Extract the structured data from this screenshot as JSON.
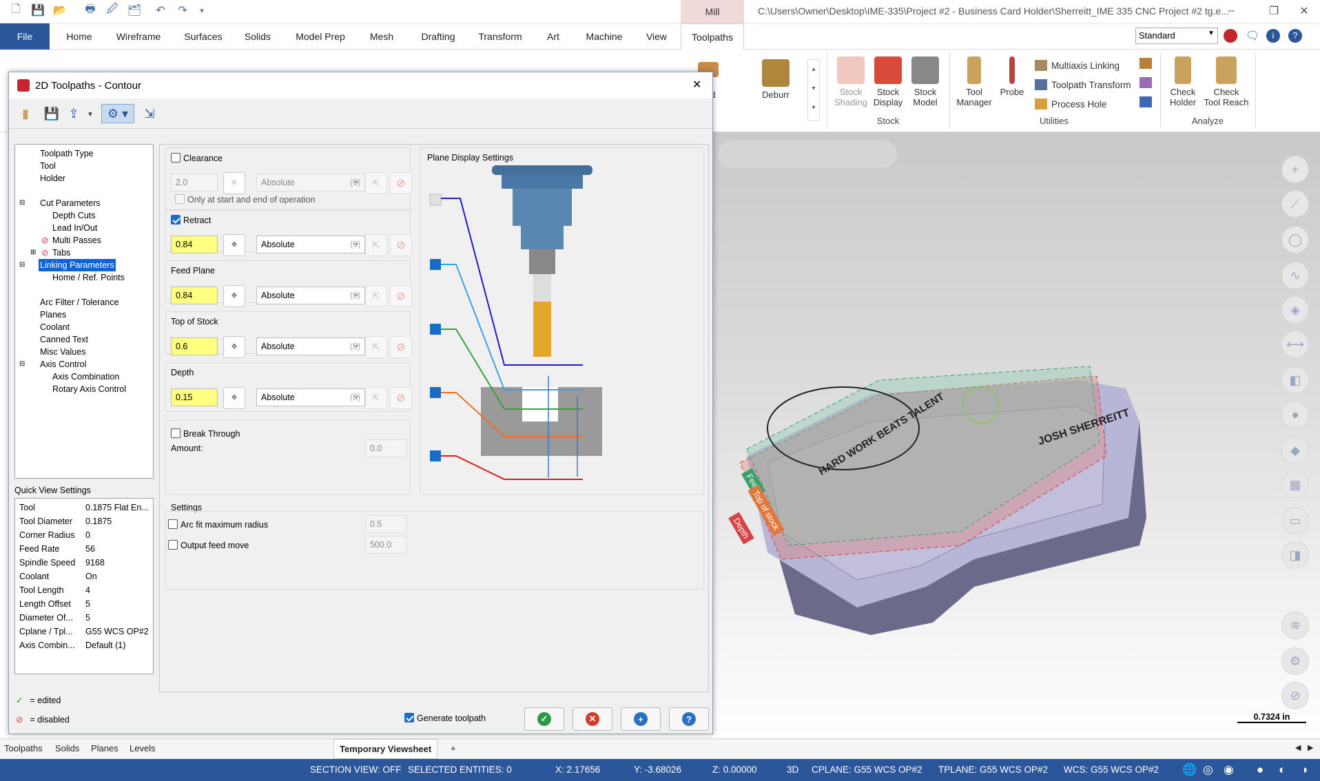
{
  "window": {
    "title": "C:\\Users\\Owner\\Desktop\\IME-335\\Project #2 - Business Card Holder\\Sherreitt_IME 335 CNC Project #2 tg.e...",
    "context_tab": "Mill",
    "minimize": "–",
    "restore": "❐",
    "close": "✕"
  },
  "menu": {
    "tabs": [
      "File",
      "Home",
      "Wireframe",
      "Surfaces",
      "Solids",
      "Model Prep",
      "Mesh",
      "Drafting",
      "Transform",
      "Art",
      "Machine",
      "View",
      "Toolpaths"
    ],
    "active": "Toolpaths",
    "standard_select": "Standard"
  },
  "ribbon": {
    "partial_label": "fied",
    "deburr": "Deburr",
    "stock_shading": [
      "Stock",
      "Shading"
    ],
    "stock_display": [
      "Stock",
      "Display"
    ],
    "stock_model": [
      "Stock",
      "Model"
    ],
    "stock_group": "Stock",
    "tool_manager": [
      "Tool",
      "Manager"
    ],
    "probe": "Probe",
    "multiaxis_linking": "Multiaxis Linking",
    "toolpath_transform": "Toolpath Transform",
    "process_hole": "Process Hole",
    "utilities_group": "Utilities",
    "check_holder": [
      "Check",
      "Holder"
    ],
    "check_tool_reach": [
      "Check",
      "Tool Reach"
    ],
    "analyze_group": "Analyze"
  },
  "dialog": {
    "title": "2D Toolpaths - Contour",
    "close": "✕",
    "tree": [
      {
        "label": "Toolpath Type",
        "level": 0
      },
      {
        "label": "Tool",
        "level": 0
      },
      {
        "label": "Holder",
        "level": 0
      },
      {
        "label": "Cut Parameters",
        "level": 0,
        "expander": "−"
      },
      {
        "label": "Depth Cuts",
        "level": 1
      },
      {
        "label": "Lead In/Out",
        "level": 1
      },
      {
        "label": "Multi Passes",
        "level": 1,
        "disabled": true
      },
      {
        "label": "Tabs",
        "level": 1,
        "disabled": true,
        "expander": "+"
      },
      {
        "label": "Linking Parameters",
        "level": 0,
        "selected": true,
        "expander": "−"
      },
      {
        "label": "Home / Ref. Points",
        "level": 1
      },
      {
        "label": "Arc Filter / Tolerance",
        "level": 0
      },
      {
        "label": "Planes",
        "level": 0
      },
      {
        "label": "Coolant",
        "level": 0
      },
      {
        "label": "Canned Text",
        "level": 0
      },
      {
        "label": "Misc Values",
        "level": 0
      },
      {
        "label": "Axis Control",
        "level": 0,
        "expander": "−"
      },
      {
        "label": "Axis Combination",
        "level": 1
      },
      {
        "label": "Rotary Axis Control",
        "level": 1
      }
    ],
    "quick_view_title": "Quick View Settings",
    "quick_view": [
      {
        "k": "Tool",
        "v": "0.1875 Flat En..."
      },
      {
        "k": "Tool Diameter",
        "v": "0.1875"
      },
      {
        "k": "Corner Radius",
        "v": "0"
      },
      {
        "k": "Feed Rate",
        "v": "56"
      },
      {
        "k": "Spindle Speed",
        "v": "9168"
      },
      {
        "k": "Coolant",
        "v": "On"
      },
      {
        "k": "Tool Length",
        "v": "4"
      },
      {
        "k": "Length Offset",
        "v": "5"
      },
      {
        "k": "Diameter Of...",
        "v": "5"
      },
      {
        "k": "Cplane / Tpl...",
        "v": "G55 WCS OP#2"
      },
      {
        "k": "Axis Combin...",
        "v": "Default (1)"
      }
    ],
    "legend_edited": "= edited",
    "legend_disabled": "= disabled",
    "clearance": {
      "label": "Clearance",
      "checked": false,
      "value": "2.0",
      "mode": "Absolute",
      "zero": "(0)",
      "only_start_end": "Only at start and end of operation"
    },
    "retract": {
      "label": "Retract",
      "checked": true,
      "value": "0.84",
      "mode": "Absolute",
      "zero": "(0)"
    },
    "feed_plane": {
      "label": "Feed Plane",
      "value": "0.84",
      "mode": "Absolute",
      "zero": "(0)"
    },
    "top_of_stock": {
      "label": "Top of Stock",
      "value": "0.6",
      "mode": "Absolute",
      "zero": "(0)"
    },
    "depth": {
      "label": "Depth",
      "value": "0.15",
      "mode": "Absolute",
      "zero": "(0)"
    },
    "break_through": {
      "label": "Break Through",
      "checked": false,
      "amount_label": "Amount:",
      "amount": "0.0"
    },
    "plane_display": "Plane Display Settings",
    "settings_title": "Settings",
    "arc_fit": {
      "label": "Arc fit maximum radius",
      "value": "0.5"
    },
    "output_feed": {
      "label": "Output feed move",
      "value": "500.0"
    },
    "generate_toolpath": "Generate toolpath"
  },
  "viewport": {
    "scale": "0.7324 in",
    "engraving_1": "HARD WORK BEATS TALENT",
    "engraving_2": "JOSH SHERREITT",
    "plane_labels": [
      "Feed",
      "Top of stock",
      "Depth"
    ]
  },
  "bottom_tabs": [
    "Toolpaths",
    "Solids",
    "Planes",
    "Levels"
  ],
  "viewsheet": "Temporary Viewsheet",
  "add_viewsheet": "+",
  "status": {
    "section_view": "SECTION VIEW: OFF",
    "selected": "SELECTED ENTITIES: 0",
    "x": "X:  2.17656",
    "y": "Y:  -3.68026",
    "z": "Z:  0.00000",
    "mode": "3D",
    "cplane": "CPLANE: G55 WCS OP#2",
    "tplane": "TPLANE: G55 WCS OP#2",
    "wcs": "WCS: G55 WCS OP#2"
  },
  "colors": {
    "accent": "#2b579a",
    "highlight": "#ffff80",
    "selected": "#0a64d8"
  }
}
